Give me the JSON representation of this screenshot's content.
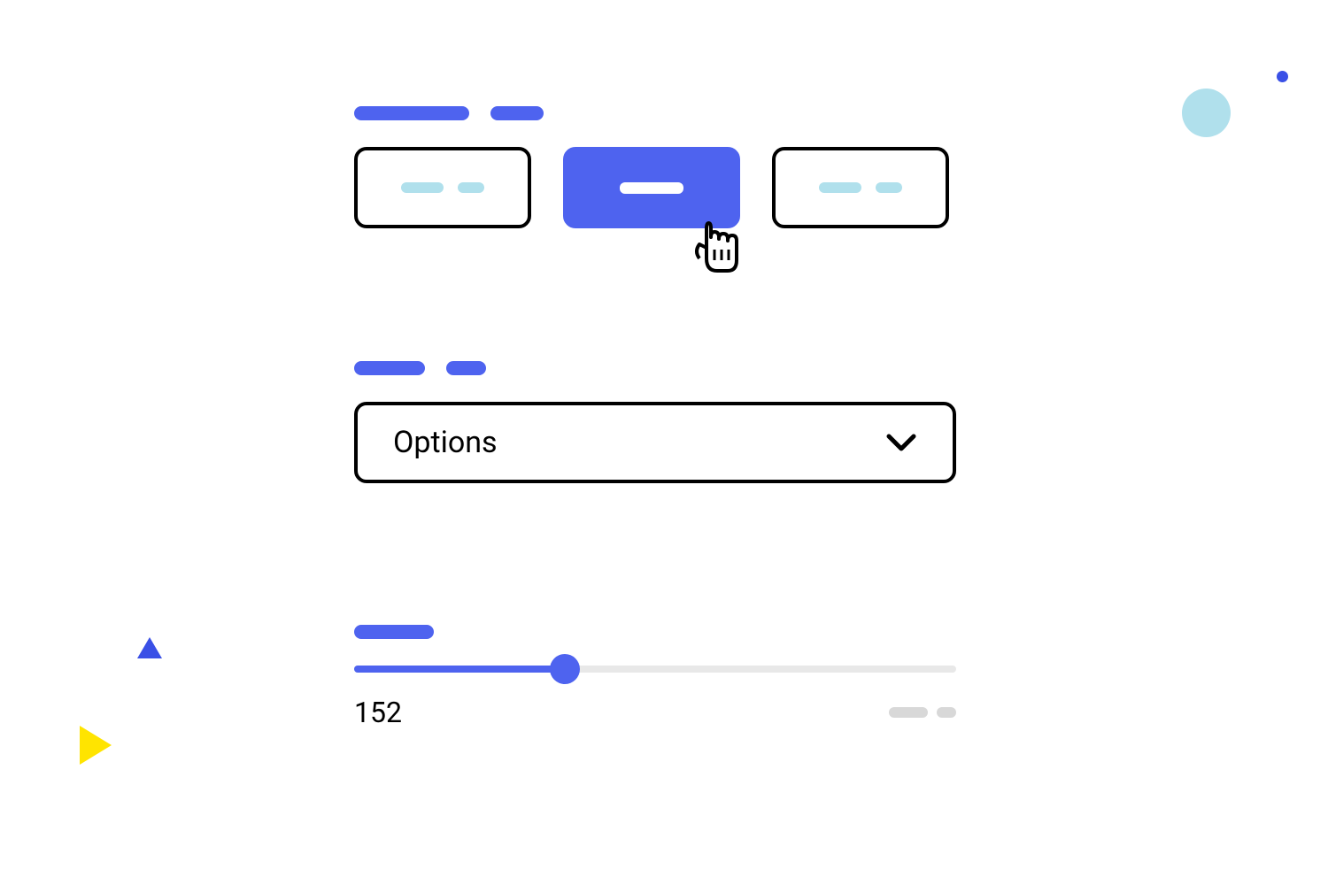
{
  "select": {
    "label": "Options"
  },
  "slider": {
    "value": "152"
  }
}
